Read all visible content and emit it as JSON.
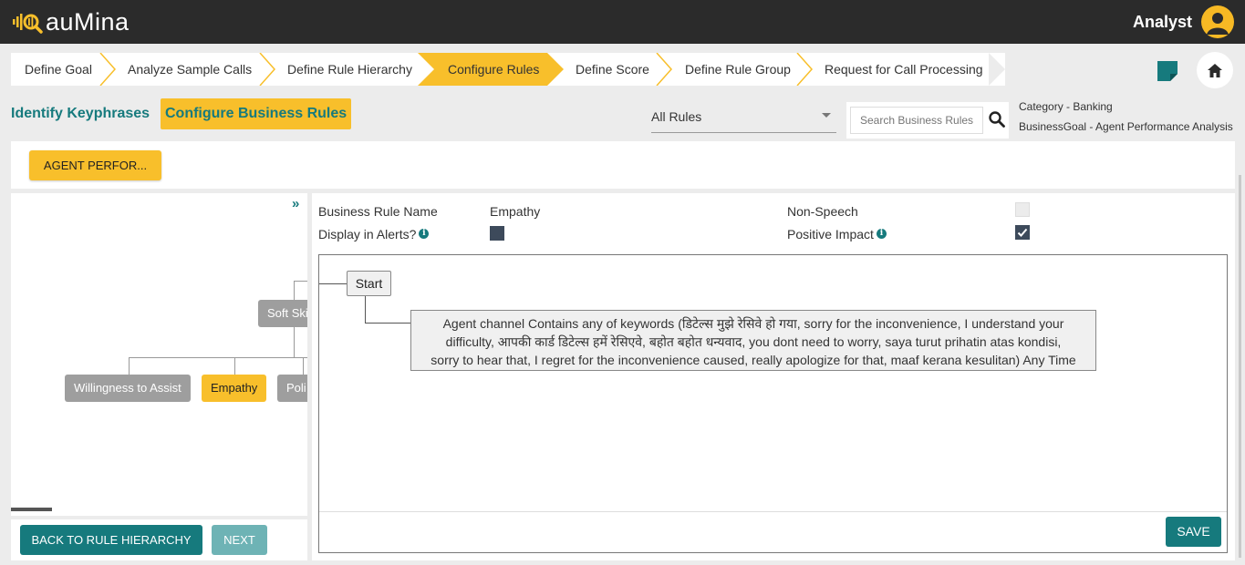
{
  "app": {
    "brand": "auMina",
    "user_role": "Analyst",
    "accent": "#f8bf2b",
    "primary": "#167a7d"
  },
  "stepper": {
    "steps": [
      {
        "label": "Define Goal",
        "active": false
      },
      {
        "label": "Analyze Sample Calls",
        "active": false
      },
      {
        "label": "Define Rule Hierarchy",
        "active": false
      },
      {
        "label": "Configure Rules",
        "active": true
      },
      {
        "label": "Define Score",
        "active": false
      },
      {
        "label": "Define Rule Group",
        "active": false
      },
      {
        "label": "Request for Call Processing",
        "active": false
      }
    ]
  },
  "toolbar": {
    "sticky_icon": "sticky-note-icon",
    "home_icon": "home-icon"
  },
  "subtabs": {
    "keyphrases": "Identify Keyphrases",
    "business_rules": "Configure Business Rules"
  },
  "filter": {
    "selected": "All Rules"
  },
  "search": {
    "placeholder": "Search Business Rules"
  },
  "meta": {
    "category": "Category - Banking",
    "business_goal": "BusinessGoal - Agent Performance Analysis"
  },
  "goal_button": "AGENT PERFOR...",
  "tree": {
    "expand_glyph": "»",
    "parent": "Soft Ski",
    "children": [
      "Willingness to Assist",
      "Empathy",
      "Poli"
    ]
  },
  "actions": {
    "back": "BACK TO RULE HIERARCHY",
    "next": "NEXT"
  },
  "rule": {
    "name_label": "Business Rule Name",
    "name_value": "Empathy",
    "alerts_label": "Display in Alerts?",
    "non_speech_label": "Non-Speech",
    "positive_label": "Positive Impact",
    "display_in_alerts": true,
    "non_speech": false,
    "positive_impact": true,
    "start_label": "Start",
    "condition_lines": [
      "Agent channel Contains any of keywords (डिटेल्स मुझे रेसिवे हो गया, sorry for the inconvenience, I understand your",
      "difficulty, आपकी कार्ड डिटेल्स हमें रेसिएवे, बहोत बहोत धन्यवाद, you dont need to worry, saya turut prihatin atas kondisi,",
      "sorry to hear that, I regret for the inconvenience caused, really apologize for that, maaf kerana kesulitan) Any Time"
    ],
    "save": "SAVE"
  }
}
